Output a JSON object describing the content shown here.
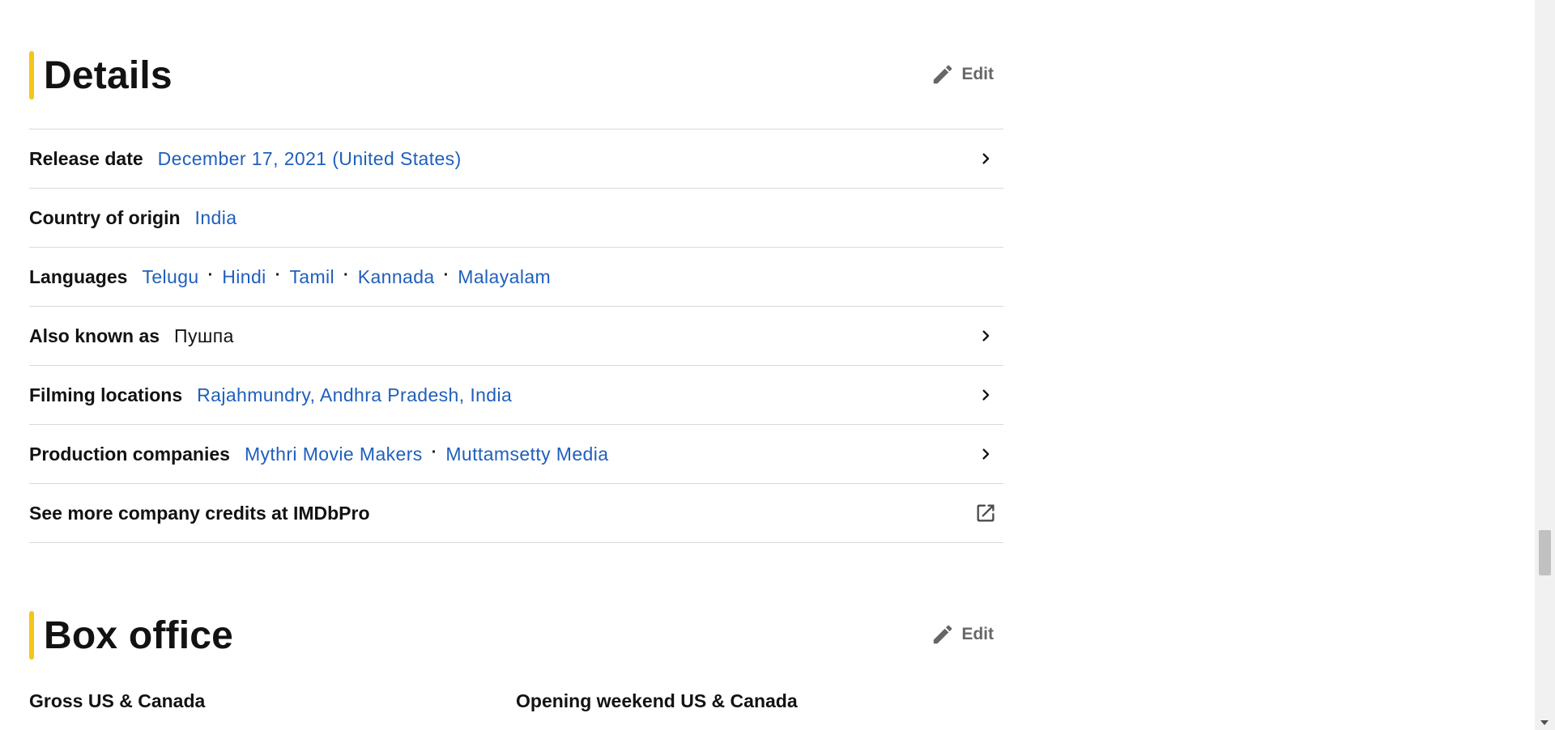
{
  "details": {
    "title": "Details",
    "edit_label": "Edit",
    "rows": [
      {
        "label": "Release date",
        "values": [
          "December 17, 2021 (United States)"
        ]
      },
      {
        "label": "Country of origin",
        "values": [
          "India"
        ]
      },
      {
        "label": "Languages",
        "values": [
          "Telugu",
          "Hindi",
          "Tamil",
          "Kannada",
          "Malayalam"
        ]
      },
      {
        "label": "Also known as",
        "values": [
          "Пушпа"
        ]
      },
      {
        "label": "Filming locations",
        "values": [
          "Rajahmundry, Andhra Pradesh, India"
        ]
      },
      {
        "label": "Production companies",
        "values": [
          "Mythri Movie Makers",
          "Muttamsetty Media"
        ]
      }
    ],
    "imdbpro_link": "See more company credits at IMDbPro",
    "separator": "·"
  },
  "box_office": {
    "title": "Box office",
    "edit_label": "Edit",
    "gross_label": "Gross US & Canada",
    "opening_label": "Opening weekend US & Canada"
  },
  "icons": {
    "edit": "pencil-icon",
    "chevron": "chevron-right-icon",
    "external": "external-link-icon"
  },
  "colors": {
    "accent": "#f5c518",
    "link": "#1f5fbd",
    "text": "#121212",
    "divider": "#d9d9d9"
  }
}
